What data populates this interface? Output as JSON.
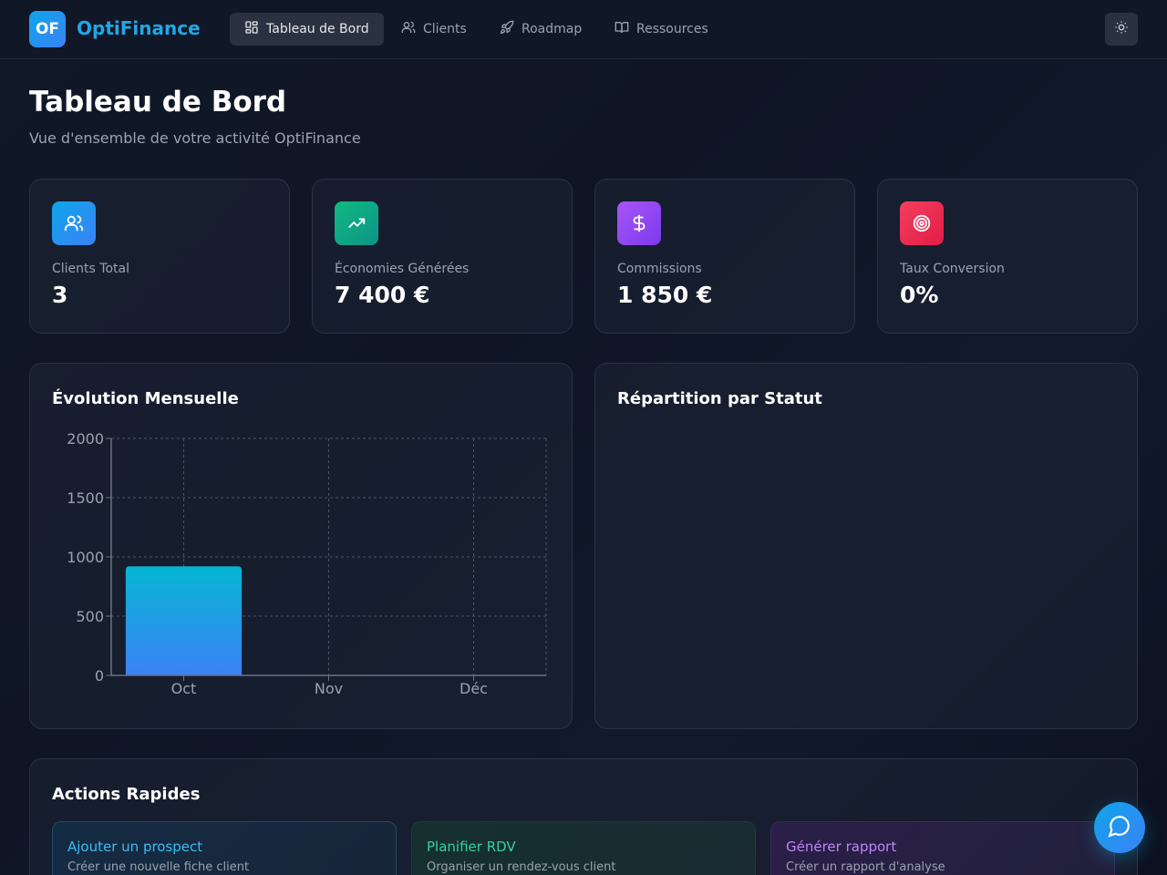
{
  "nav": {
    "logo_text": "OF",
    "brand": "OptiFinance",
    "items": [
      {
        "label": "Tableau de Bord",
        "icon": "dashboard-icon",
        "active": true
      },
      {
        "label": "Clients",
        "icon": "users-icon",
        "active": false
      },
      {
        "label": "Roadmap",
        "icon": "rocket-icon",
        "active": false
      },
      {
        "label": "Ressources",
        "icon": "book-icon",
        "active": false
      }
    ],
    "theme_icon": "sun-icon"
  },
  "header": {
    "title": "Tableau de Bord",
    "subtitle": "Vue d'ensemble de votre activité OptiFinance"
  },
  "stats": [
    {
      "label": "Clients Total",
      "value": "3",
      "icon": "users-icon",
      "color": "#0ea5e9"
    },
    {
      "label": "Économies Générées",
      "value": "7 400 €",
      "icon": "trending-up-icon",
      "color": "#10b981"
    },
    {
      "label": "Commissions",
      "value": "1 850 €",
      "icon": "dollar-icon",
      "color": "#a855f7"
    },
    {
      "label": "Taux Conversion",
      "value": "0%",
      "icon": "target-icon",
      "color": "#f43f5e"
    }
  ],
  "monthly_chart": {
    "title": "Évolution Mensuelle"
  },
  "status_chart": {
    "title": "Répartition par Statut"
  },
  "chart_data": {
    "type": "bar",
    "title": "Évolution Mensuelle",
    "categories": [
      "Oct",
      "Nov",
      "Déc"
    ],
    "values": [
      920,
      0,
      0
    ],
    "yticks": [
      0,
      500,
      1000,
      1500,
      2000
    ],
    "ylim": [
      0,
      2000
    ],
    "xlabel": "",
    "ylabel": "",
    "grid": true,
    "colors": {
      "bar_top": "#06b6d4",
      "bar_bottom": "#3b82f6",
      "grid": "#4b5563",
      "axis": "#6b7280"
    }
  },
  "actions": {
    "title": "Actions Rapides",
    "items": [
      {
        "title": "Ajouter un prospect",
        "desc": "Créer une nouvelle fiche client",
        "color": "#38bdf8"
      },
      {
        "title": "Planifier RDV",
        "desc": "Organiser un rendez-vous client",
        "color": "#34d399"
      },
      {
        "title": "Générer rapport",
        "desc": "Créer un rapport d'analyse",
        "color": "#c084fc"
      }
    ]
  },
  "fab": {
    "icon": "chat-icon"
  }
}
